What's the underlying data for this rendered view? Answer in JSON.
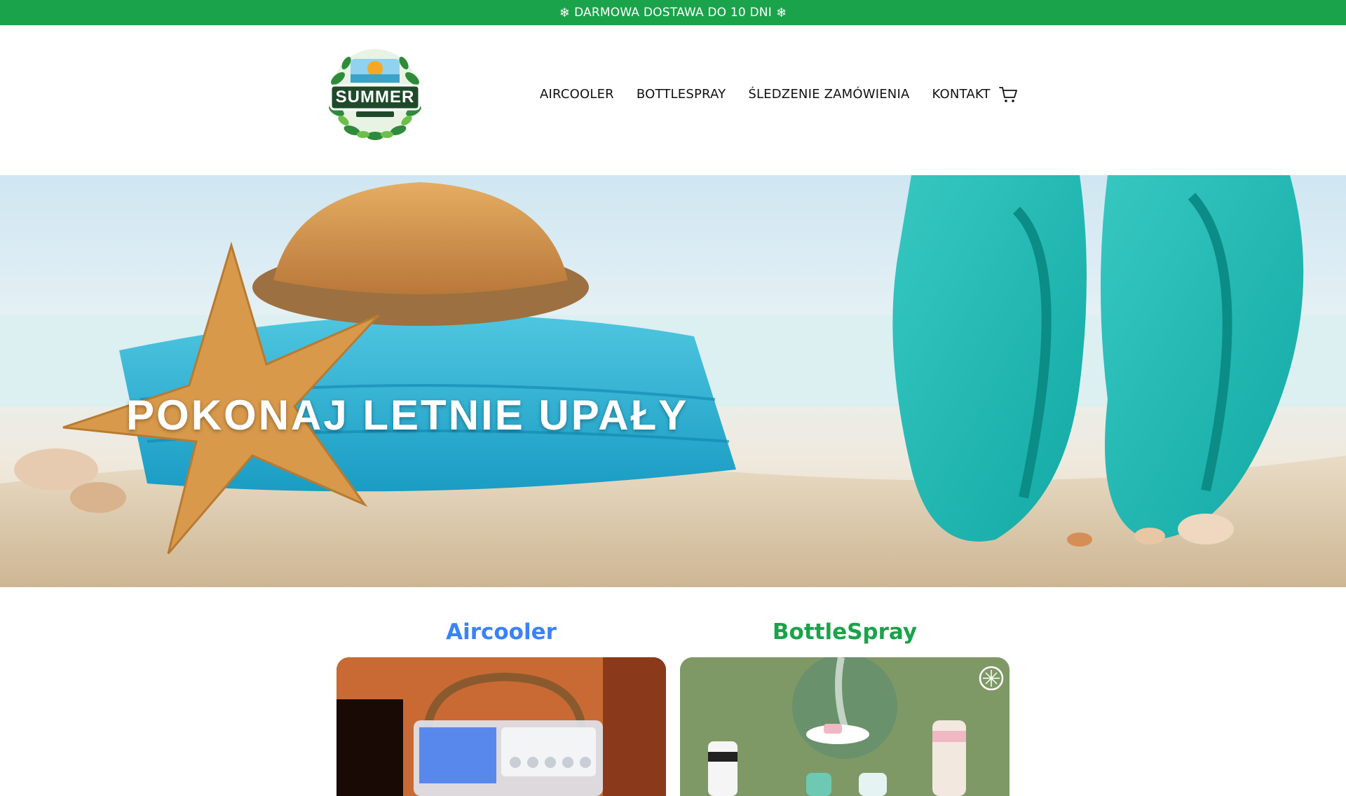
{
  "announcement": {
    "text": "DARMOWA DOSTAWA DO 10 DNI",
    "icon": "snowflake-icon"
  },
  "header": {
    "logo": {
      "icon": "summer-logo-icon",
      "text": "SUMMER"
    },
    "nav": [
      {
        "label": "AIRCOOLER"
      },
      {
        "label": "BOTTLESPRAY"
      },
      {
        "label": "ŚLEDZENIE ZAMÓWIENIA"
      },
      {
        "label": "KONTAKT"
      }
    ],
    "cart_icon": "cart-icon"
  },
  "hero": {
    "title": "POKONAJ LETNIE UPAŁY"
  },
  "products": [
    {
      "title": "Aircooler",
      "color": "#3b82f6"
    },
    {
      "title": "BottleSpray",
      "color": "#1aa34a"
    }
  ],
  "colors": {
    "accent_green": "#1aa34a",
    "accent_blue": "#3b82f6"
  }
}
